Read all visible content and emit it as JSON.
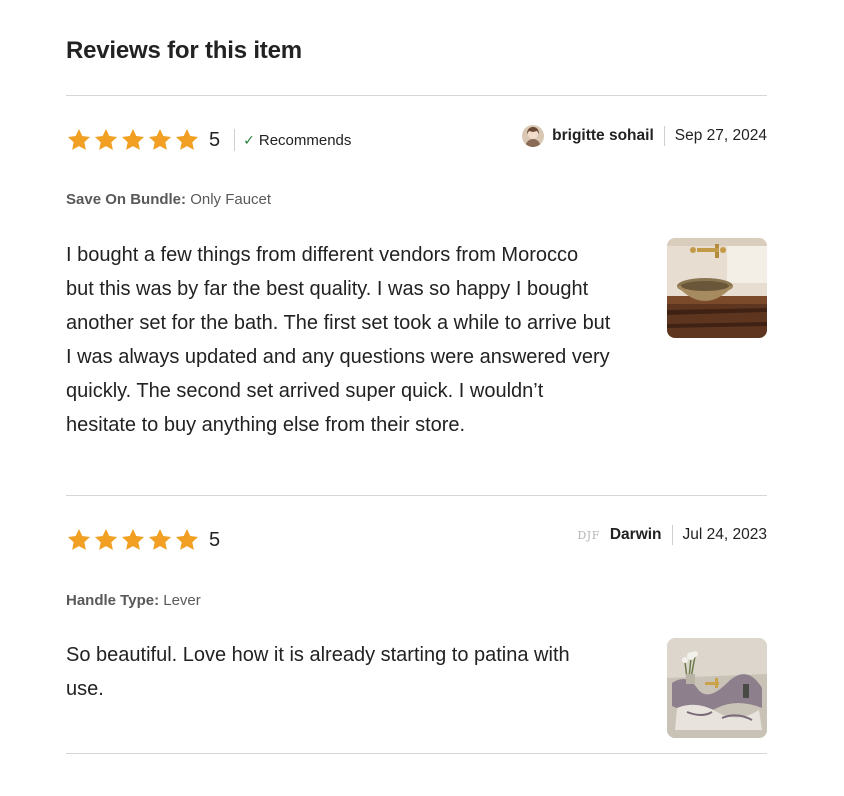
{
  "section": {
    "title": "Reviews for this item"
  },
  "reviews": [
    {
      "rating": "5",
      "recommends": "Recommends",
      "author": "brigitte sohail",
      "date": "Sep 27, 2024",
      "variation_label": "Save On Bundle:",
      "variation_value": "Only Faucet",
      "text": "I bought a few things from different vendors from Morocco but this was by far the best quality. I was so happy I bought another set for the bath. The first set took a while to arrive but I was always updated and any questions were answered very quickly. The second set arrived super quick. I wouldn’t hesitate to buy anything else from their store."
    },
    {
      "rating": "5",
      "author": "Darwin",
      "logo_text": "DJF",
      "date": "Jul 24, 2023",
      "variation_label": "Handle Type:",
      "variation_value": "Lever",
      "text": "So beautiful. Love how it is already starting to patina with use."
    }
  ],
  "colors": {
    "star": "#f1a023",
    "divider": "#d6d6d6",
    "check": "#2a7f3e"
  },
  "icons": {
    "star": "star-icon",
    "check": "checkmark-icon"
  }
}
